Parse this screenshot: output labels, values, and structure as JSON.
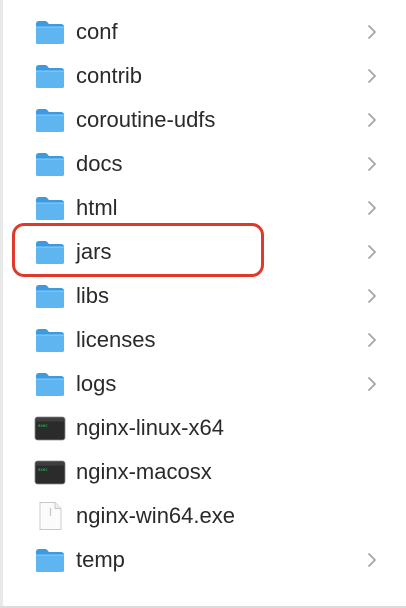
{
  "file_list": {
    "items": [
      {
        "name": "conf",
        "kind": "folder",
        "has_chevron": true,
        "icon": "folder-icon"
      },
      {
        "name": "contrib",
        "kind": "folder",
        "has_chevron": true,
        "icon": "folder-icon"
      },
      {
        "name": "coroutine-udfs",
        "kind": "folder",
        "has_chevron": true,
        "icon": "folder-icon"
      },
      {
        "name": "docs",
        "kind": "folder",
        "has_chevron": true,
        "icon": "folder-icon"
      },
      {
        "name": "html",
        "kind": "folder",
        "has_chevron": true,
        "icon": "folder-icon"
      },
      {
        "name": "jars",
        "kind": "folder",
        "has_chevron": true,
        "icon": "folder-icon",
        "highlighted": true
      },
      {
        "name": "libs",
        "kind": "folder",
        "has_chevron": true,
        "icon": "folder-icon"
      },
      {
        "name": "licenses",
        "kind": "folder",
        "has_chevron": true,
        "icon": "folder-icon"
      },
      {
        "name": "logs",
        "kind": "folder",
        "has_chevron": true,
        "icon": "folder-icon"
      },
      {
        "name": "nginx-linux-x64",
        "kind": "executable",
        "has_chevron": false,
        "icon": "terminal-executable-icon"
      },
      {
        "name": "nginx-macosx",
        "kind": "executable",
        "has_chevron": false,
        "icon": "terminal-executable-icon"
      },
      {
        "name": "nginx-win64.exe",
        "kind": "document",
        "has_chevron": false,
        "icon": "blank-document-icon"
      },
      {
        "name": "temp",
        "kind": "folder",
        "has_chevron": true,
        "icon": "folder-icon"
      }
    ]
  },
  "colors": {
    "highlight_border": "#e0392b",
    "folder_front": "#5eb5f0",
    "folder_back": "#3c9ae0",
    "text": "#2a2a2a",
    "chevron": "#a6a6a6"
  }
}
